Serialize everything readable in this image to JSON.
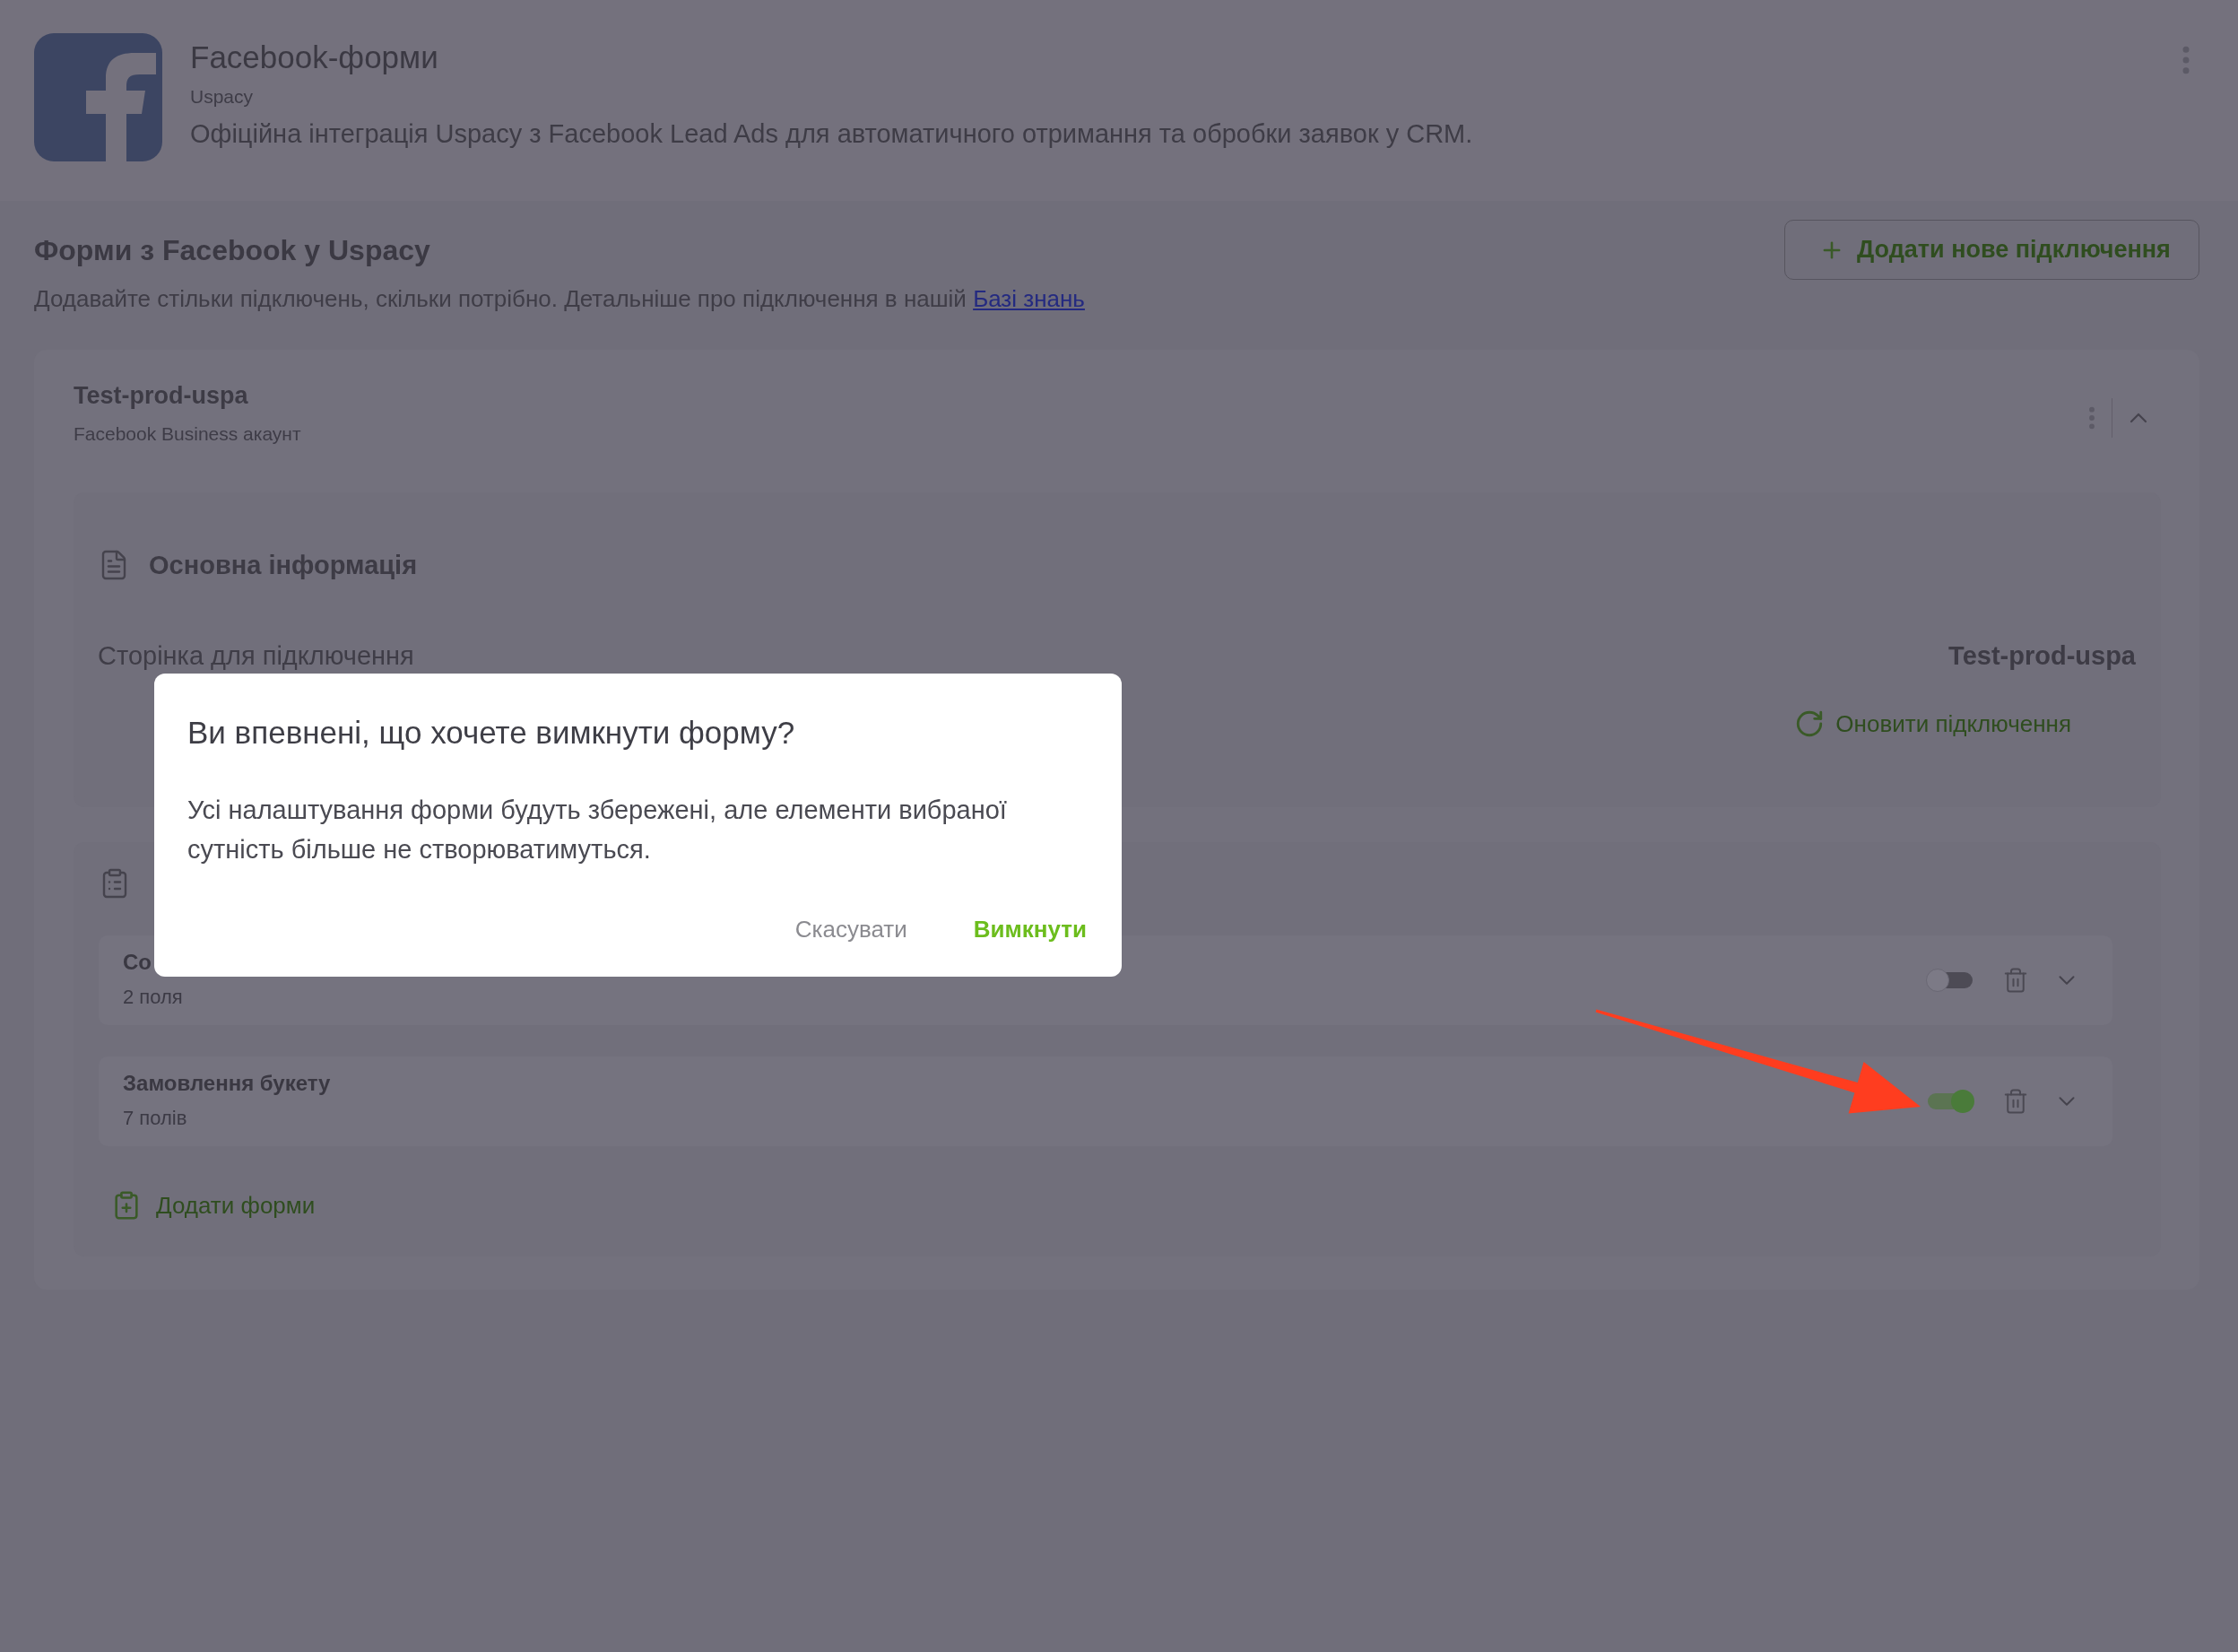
{
  "app": {
    "title": "Facebook-форми",
    "vendor": "Uspacy",
    "description": "Офіційна інтеграція Uspacy з Facebook Lead Ads для автоматичного отримання та обробки заявок у CRM."
  },
  "section": {
    "title": "Форми з Facebook у Uspacy",
    "description": "Додавайте стільки підключень, скільки потрібно. Детальніше про підключення в нашій",
    "link": "Базі знань",
    "add_button": "Додати нове підключення"
  },
  "connection": {
    "name": "Test-prod-uspa",
    "subtitle": "Facebook Business акаунт",
    "expanded": true,
    "basic_info": {
      "title": "Основна інформація",
      "page_label": "Сторінка для підключення",
      "page_value": "Test-prod-uspa",
      "refresh_button": "Оновити підключення"
    },
    "forms": {
      "items": [
        {
          "name": "Со",
          "fields": "2 поля",
          "on": false,
          "expanded": false
        },
        {
          "name": "Замовлення букету",
          "fields": "7 полів",
          "on": true,
          "expanded": false
        }
      ],
      "add_button": "Додати форми"
    }
  },
  "dialog": {
    "title": "Ви впевнені, що хочете вимкнути форму?",
    "message": "Усі налаштування форми будуть збережені, але елементи вибраної сутність більше не створюватимуться.",
    "buttons": [
      {
        "label": "Скасувати",
        "kind": "cancel"
      },
      {
        "label": "Вимкнути",
        "kind": "confirm"
      }
    ]
  }
}
